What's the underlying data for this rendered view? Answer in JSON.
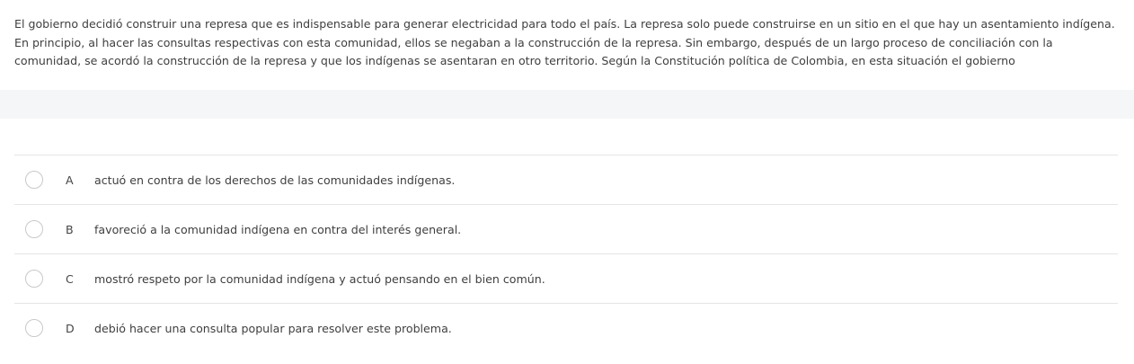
{
  "question": {
    "text": "El gobierno decidió construir una represa que es indispensable para generar electricidad para todo el país. La represa solo puede construirse en un sitio en el que hay un asentamiento indígena. En principio, al hacer las consultas respectivas con esta comunidad, ellos se negaban a la construcción de la represa. Sin embargo, después de un largo proceso de conciliación con la comunidad, se acordó la construcción de la represa y que los indígenas se asentaran en otro territorio. Según la Constitución política de Colombia, en esta situación el gobierno"
  },
  "options": [
    {
      "letter": "A",
      "text": "actuó en contra de los derechos de las comunidades indígenas."
    },
    {
      "letter": "B",
      "text": "favoreció a la comunidad indígena en contra del interés general."
    },
    {
      "letter": "C",
      "text": "mostró respeto por la comunidad indígena y actuó pensando en el bien común."
    },
    {
      "letter": "D",
      "text": "debió hacer una consulta popular para resolver este problema."
    }
  ]
}
